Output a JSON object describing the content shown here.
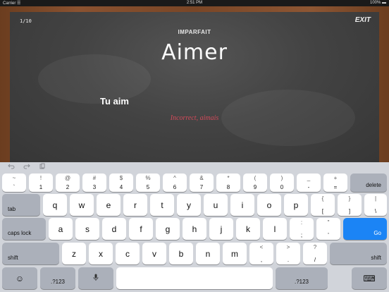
{
  "status_bar": {
    "carrier": "Carrier ☰",
    "time": "2:51 PM",
    "battery": "100% ▬"
  },
  "board": {
    "progress": "1/10",
    "exit_label": "EXIT",
    "tense": "IMPARFAIT",
    "verb": "Aimer",
    "answer": "Tu aim",
    "feedback": "Incorrect, aimais"
  },
  "toolbar": {
    "undo_icon": "undo-icon",
    "redo_icon": "redo-icon",
    "paste_icon": "paste-icon"
  },
  "keyboard": {
    "row1": [
      {
        "top": "~",
        "bot": "`"
      },
      {
        "top": "!",
        "bot": "1"
      },
      {
        "top": "@",
        "bot": "2"
      },
      {
        "top": "#",
        "bot": "3"
      },
      {
        "top": "$",
        "bot": "4"
      },
      {
        "top": "%",
        "bot": "5"
      },
      {
        "top": "^",
        "bot": "6"
      },
      {
        "top": "&",
        "bot": "7"
      },
      {
        "top": "*",
        "bot": "8"
      },
      {
        "top": "(",
        "bot": "9"
      },
      {
        "top": ")",
        "bot": "0"
      },
      {
        "top": "_",
        "bot": "-"
      },
      {
        "top": "+",
        "bot": "="
      }
    ],
    "delete_label": "delete",
    "tab_label": "tab",
    "row2": [
      "q",
      "w",
      "e",
      "r",
      "t",
      "y",
      "u",
      "i",
      "o",
      "p"
    ],
    "row2_sym": [
      {
        "top": "{",
        "bot": "["
      },
      {
        "top": "}",
        "bot": "]"
      },
      {
        "top": "|",
        "bot": "\\"
      }
    ],
    "caps_label": "caps lock",
    "row3": [
      "a",
      "s",
      "d",
      "f",
      "g",
      "h",
      "j",
      "k",
      "l"
    ],
    "row3_sym": [
      {
        "top": ":",
        "bot": ";"
      },
      {
        "top": "\"",
        "bot": "'"
      }
    ],
    "go_label": "Go",
    "shift_label": "shift",
    "row4": [
      "z",
      "x",
      "c",
      "v",
      "b",
      "n",
      "m"
    ],
    "row4_sym": [
      {
        "top": "<",
        "bot": ","
      },
      {
        "top": ">",
        "bot": "."
      },
      {
        "top": "?",
        "bot": "/"
      }
    ],
    "emoji_glyph": "☺",
    "num_label": ".?123",
    "mic_glyph": "🎙",
    "hide_glyph": "⌨"
  }
}
